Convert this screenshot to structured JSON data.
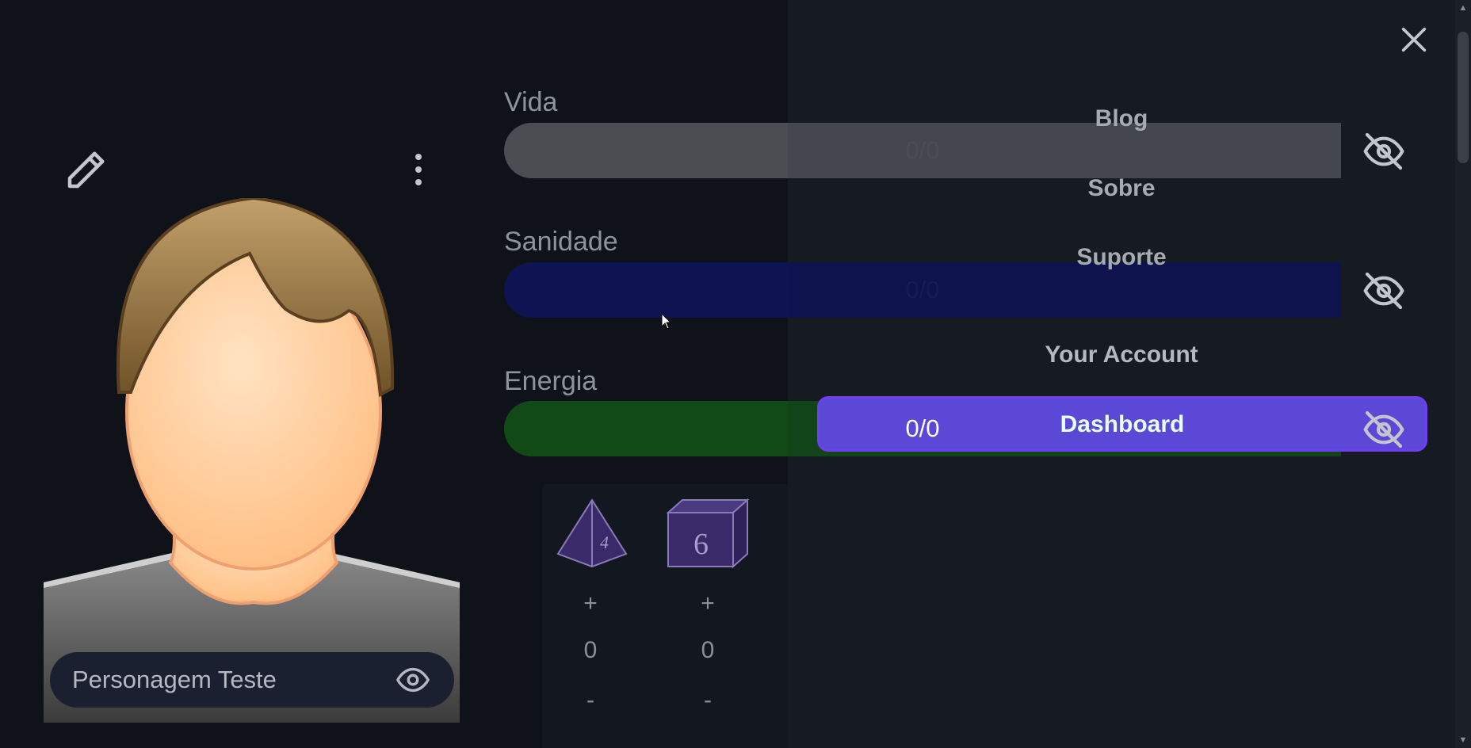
{
  "character": {
    "name": "Personagem Teste"
  },
  "stats": [
    {
      "label": "Vida",
      "value": "0/0",
      "color": "#4a4d52"
    },
    {
      "label": "Sanidade",
      "value": "0/0",
      "color": "#0e1352"
    },
    {
      "label": "Energia",
      "value": "0/0",
      "color": "#124a17"
    }
  ],
  "dice": [
    {
      "face": "4",
      "plus": "+",
      "count": "0",
      "minus": "-",
      "color": "#3a2a6a"
    },
    {
      "face": "6",
      "plus": "+",
      "count": "0",
      "minus": "-",
      "color": "#3a2a6a"
    }
  ],
  "menu": {
    "items": [
      "Blog",
      "Sobre",
      "Suporte",
      "Your Account"
    ],
    "active": "Dashboard",
    "active_color": "#5b48d6"
  },
  "icons": {
    "edit": "pencil-icon",
    "more": "kebab-icon",
    "visible": "eye-icon",
    "hidden": "eye-off-icon",
    "close": "close-icon"
  }
}
